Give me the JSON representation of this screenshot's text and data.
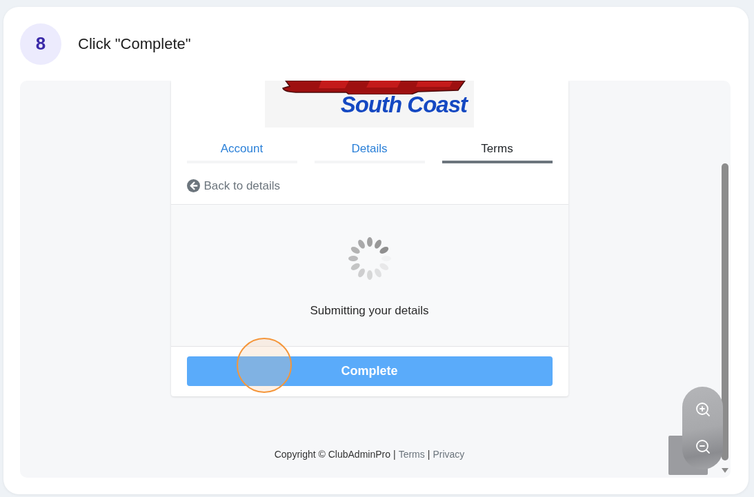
{
  "step": {
    "number": "8",
    "instruction": "Click \"Complete\""
  },
  "logo": {
    "text": "South Coast"
  },
  "tabs": [
    {
      "label": "Account",
      "selected": false
    },
    {
      "label": "Details",
      "selected": false
    },
    {
      "label": "Terms",
      "selected": true
    }
  ],
  "back_link": "Back to details",
  "status": {
    "message": "Submitting your details"
  },
  "submit_button": "Complete",
  "footer": [
    {
      "kind": "text",
      "text": "Copyright © ClubAdminPro"
    },
    {
      "kind": "separator",
      "text": "|"
    },
    {
      "kind": "link",
      "text": "Terms"
    },
    {
      "kind": "separator",
      "text": "|"
    },
    {
      "kind": "link",
      "text": "Privacy"
    }
  ]
}
